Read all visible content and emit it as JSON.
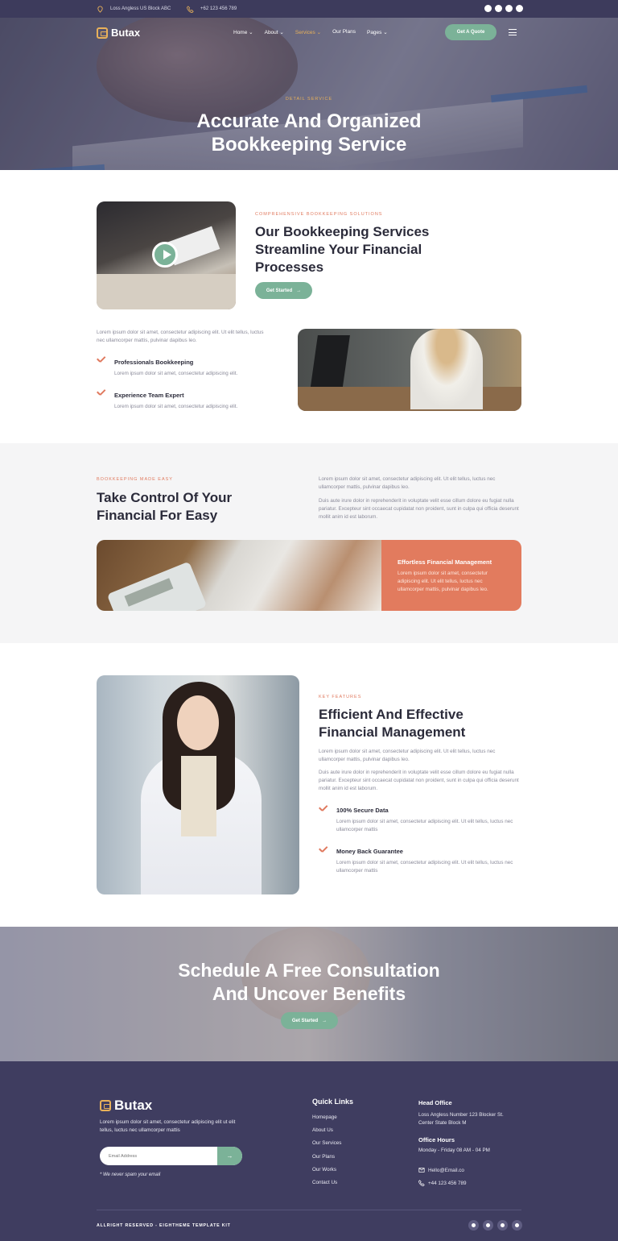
{
  "topbar": {
    "address": "Loss Angless US Block ABC",
    "phone": "+62 123 456 789"
  },
  "nav": {
    "brand": "Butax",
    "menu": [
      "Home",
      "About",
      "Services",
      "Our Plans",
      "Pages"
    ],
    "active": "Services",
    "quote_button": "Get A Quote"
  },
  "hero": {
    "eyebrow": "DETAIL SERVICE",
    "title_line1": "Accurate And Organized",
    "title_line2": "Bookkeeping Service"
  },
  "section2": {
    "eyebrow": "COMPREHENSIVE BOOKKEEPING SOLUTIONS",
    "title": "Our Bookkeeping Services Streamline Your Financial Processes",
    "button": "Get Started",
    "para": "Lorem ipsum dolor sit amet, consectetur adipiscing elit. Ut elit tellus, luctus nec ullamcorper mattis, pulvinar dapibus leo.",
    "features": [
      {
        "title": "Professionals Bookkeeping",
        "desc": "Lorem ipsum dolor sit amet, consectetur adipiscing elit."
      },
      {
        "title": "Experience Team Expert",
        "desc": "Lorem ipsum dolor sit amet, consectetur adipiscing elit."
      }
    ]
  },
  "section3": {
    "eyebrow": "BOOKKEEPING MADE EASY",
    "title": "Take Control Of Your Financial For Easy",
    "para1": "Lorem ipsum dolor sit amet, consectetur adipiscing elit. Ut elit tellus, luctus nec ullamcorper mattis, pulvinar dapibus leo.",
    "para2": "Duis aute irure dolor in reprehenderit in voluptate velit esse cillum dolore eu fugiat nulla pariatur. Excepteur sint occaecat cupidatat non proident, sunt in culpa qui officia deserunt mollit anim id est laborum.",
    "card_title": "Effortless Financial Management",
    "card_desc": "Lorem ipsum dolor sit amet, consectetur adipiscing elit. Ut elit tellus, luctus nec ullamcorper mattis, pulvinar dapibus leo."
  },
  "section4": {
    "eyebrow": "KEY FEATURES",
    "title": "Efficient And Effective Financial Management",
    "para1": "Lorem ipsum dolor sit amet, consectetur adipiscing elit. Ut elit tellus, luctus nec ullamcorper mattis, pulvinar dapibus leo.",
    "para2": "Duis aute irure dolor in reprehenderit in voluptate velit esse cillum dolore eu fugiat nulla pariatur. Excepteur sint occaecat cupidatat non proident, sunt in culpa qui officia deserunt mollit anim id est laborum.",
    "features": [
      {
        "title": "100% Secure Data",
        "desc": "Lorem ipsum dolor sit amet, consectetur adipiscing elit. Ut elit tellus, luctus nec ullamcorper mattis"
      },
      {
        "title": "Money Back Guarantee",
        "desc": "Lorem ipsum dolor sit amet, consectetur adipiscing elit. Ut elit tellus, luctus nec ullamcorper mattis"
      }
    ]
  },
  "cta": {
    "title_line1": "Schedule A Free Consultation",
    "title_line2": "And Uncover Benefits",
    "button": "Get Started"
  },
  "footer": {
    "brand": "Butax",
    "desc": "Lorem ipsum dolor sit amet, consectetur adipiscing elit ut elit tellus, luctus nec ullamcorper mattis",
    "email_placeholder": "Email Address",
    "spam_note": "* We never spam your email",
    "quick_links_title": "Quick Links",
    "quick_links": [
      "Homepage",
      "About Us",
      "Our Services",
      "Our Plans",
      "Our Works",
      "Contact Us"
    ],
    "head_office_title": "Head Office",
    "head_office_address": "Loss Angless Number 123 Blocker St. Center State Block M",
    "office_hours_title": "Office Hours",
    "office_hours": "Monday - Friday 08 AM - 04 PM",
    "email": "Hello@Email.co",
    "phone": "+44 123 456 789",
    "copyright": "ALLRIGHT RESERVED - EIGHTHEME TEMPLATE KIT"
  },
  "colors": {
    "navy": "#3d3b5c",
    "green": "#7bb298",
    "orange": "#e07a5f",
    "gold": "#e8b15a"
  },
  "icons": [
    "map-pin-icon",
    "phone-icon",
    "facebook-icon",
    "twitter-icon",
    "youtube-icon",
    "pinterest-icon",
    "chevron-down-icon",
    "menu-icon",
    "play-icon",
    "check-icon",
    "arrow-right-icon",
    "mail-icon"
  ]
}
